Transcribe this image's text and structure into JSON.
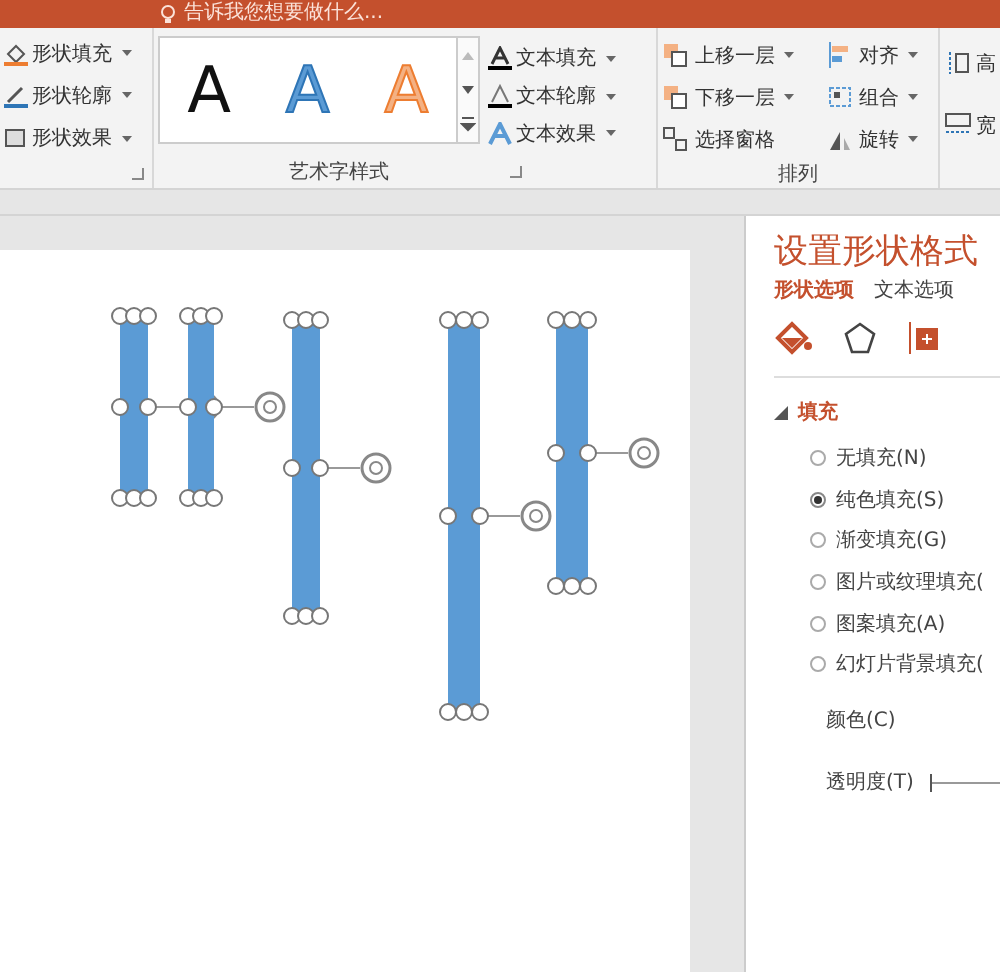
{
  "title_bar": {
    "tell_me": "告诉我您想要做什么..."
  },
  "ribbon": {
    "shape_styles": [
      {
        "kind": "fill",
        "label": "形状填充"
      },
      {
        "kind": "outline",
        "label": "形状轮廓"
      },
      {
        "kind": "effect",
        "label": "形状效果"
      }
    ],
    "wordart": {
      "label": "艺术字样式",
      "samples": [
        {
          "kind": "black",
          "text": "A"
        },
        {
          "kind": "blue",
          "text": "A"
        },
        {
          "kind": "orange",
          "text": "A"
        }
      ],
      "text_buttons": [
        {
          "kind": "fill",
          "label": "文本填充"
        },
        {
          "kind": "outline",
          "label": "文本轮廓"
        },
        {
          "kind": "effect",
          "label": "文本效果"
        }
      ]
    },
    "arrange": {
      "label": "排列",
      "buttons": [
        {
          "kind": "forward",
          "label": "上移一层",
          "dropdown": true
        },
        {
          "kind": "align",
          "label": "对齐",
          "dropdown": true
        },
        {
          "kind": "backward",
          "label": "下移一层",
          "dropdown": true
        },
        {
          "kind": "group",
          "label": "组合",
          "dropdown": true
        },
        {
          "kind": "pane",
          "label": "选择窗格",
          "dropdown": false
        },
        {
          "kind": "rotate",
          "label": "旋转",
          "dropdown": true
        }
      ]
    },
    "size": [
      {
        "kind": "height",
        "label": "高"
      },
      {
        "kind": "width",
        "label": "宽"
      }
    ]
  },
  "shapes": [
    {
      "kind": "rectangle",
      "selected": true
    },
    {
      "kind": "rectangle",
      "selected": true
    },
    {
      "kind": "rectangle",
      "selected": true
    },
    {
      "kind": "rectangle",
      "selected": true
    },
    {
      "kind": "rectangle",
      "selected": true
    }
  ],
  "format_pane": {
    "title": "设置形状格式",
    "tabs": [
      {
        "label": "形状选项",
        "selected": true
      },
      {
        "label": "文本选项",
        "selected": false
      }
    ],
    "section": {
      "label": "填充",
      "expanded": true
    },
    "fill_options": [
      {
        "label": "无填充(N)",
        "selected": false
      },
      {
        "label": "纯色填充(S)",
        "selected": true
      },
      {
        "label": "渐变填充(G)",
        "selected": false
      },
      {
        "label": "图片或纹理填充(",
        "selected": false
      },
      {
        "label": "图案填充(A)",
        "selected": false
      },
      {
        "label": "幻灯片背景填充(",
        "selected": false
      }
    ],
    "color_label": "颜色(C)",
    "transparency": {
      "label": "透明度(T)",
      "level": 0
    }
  }
}
